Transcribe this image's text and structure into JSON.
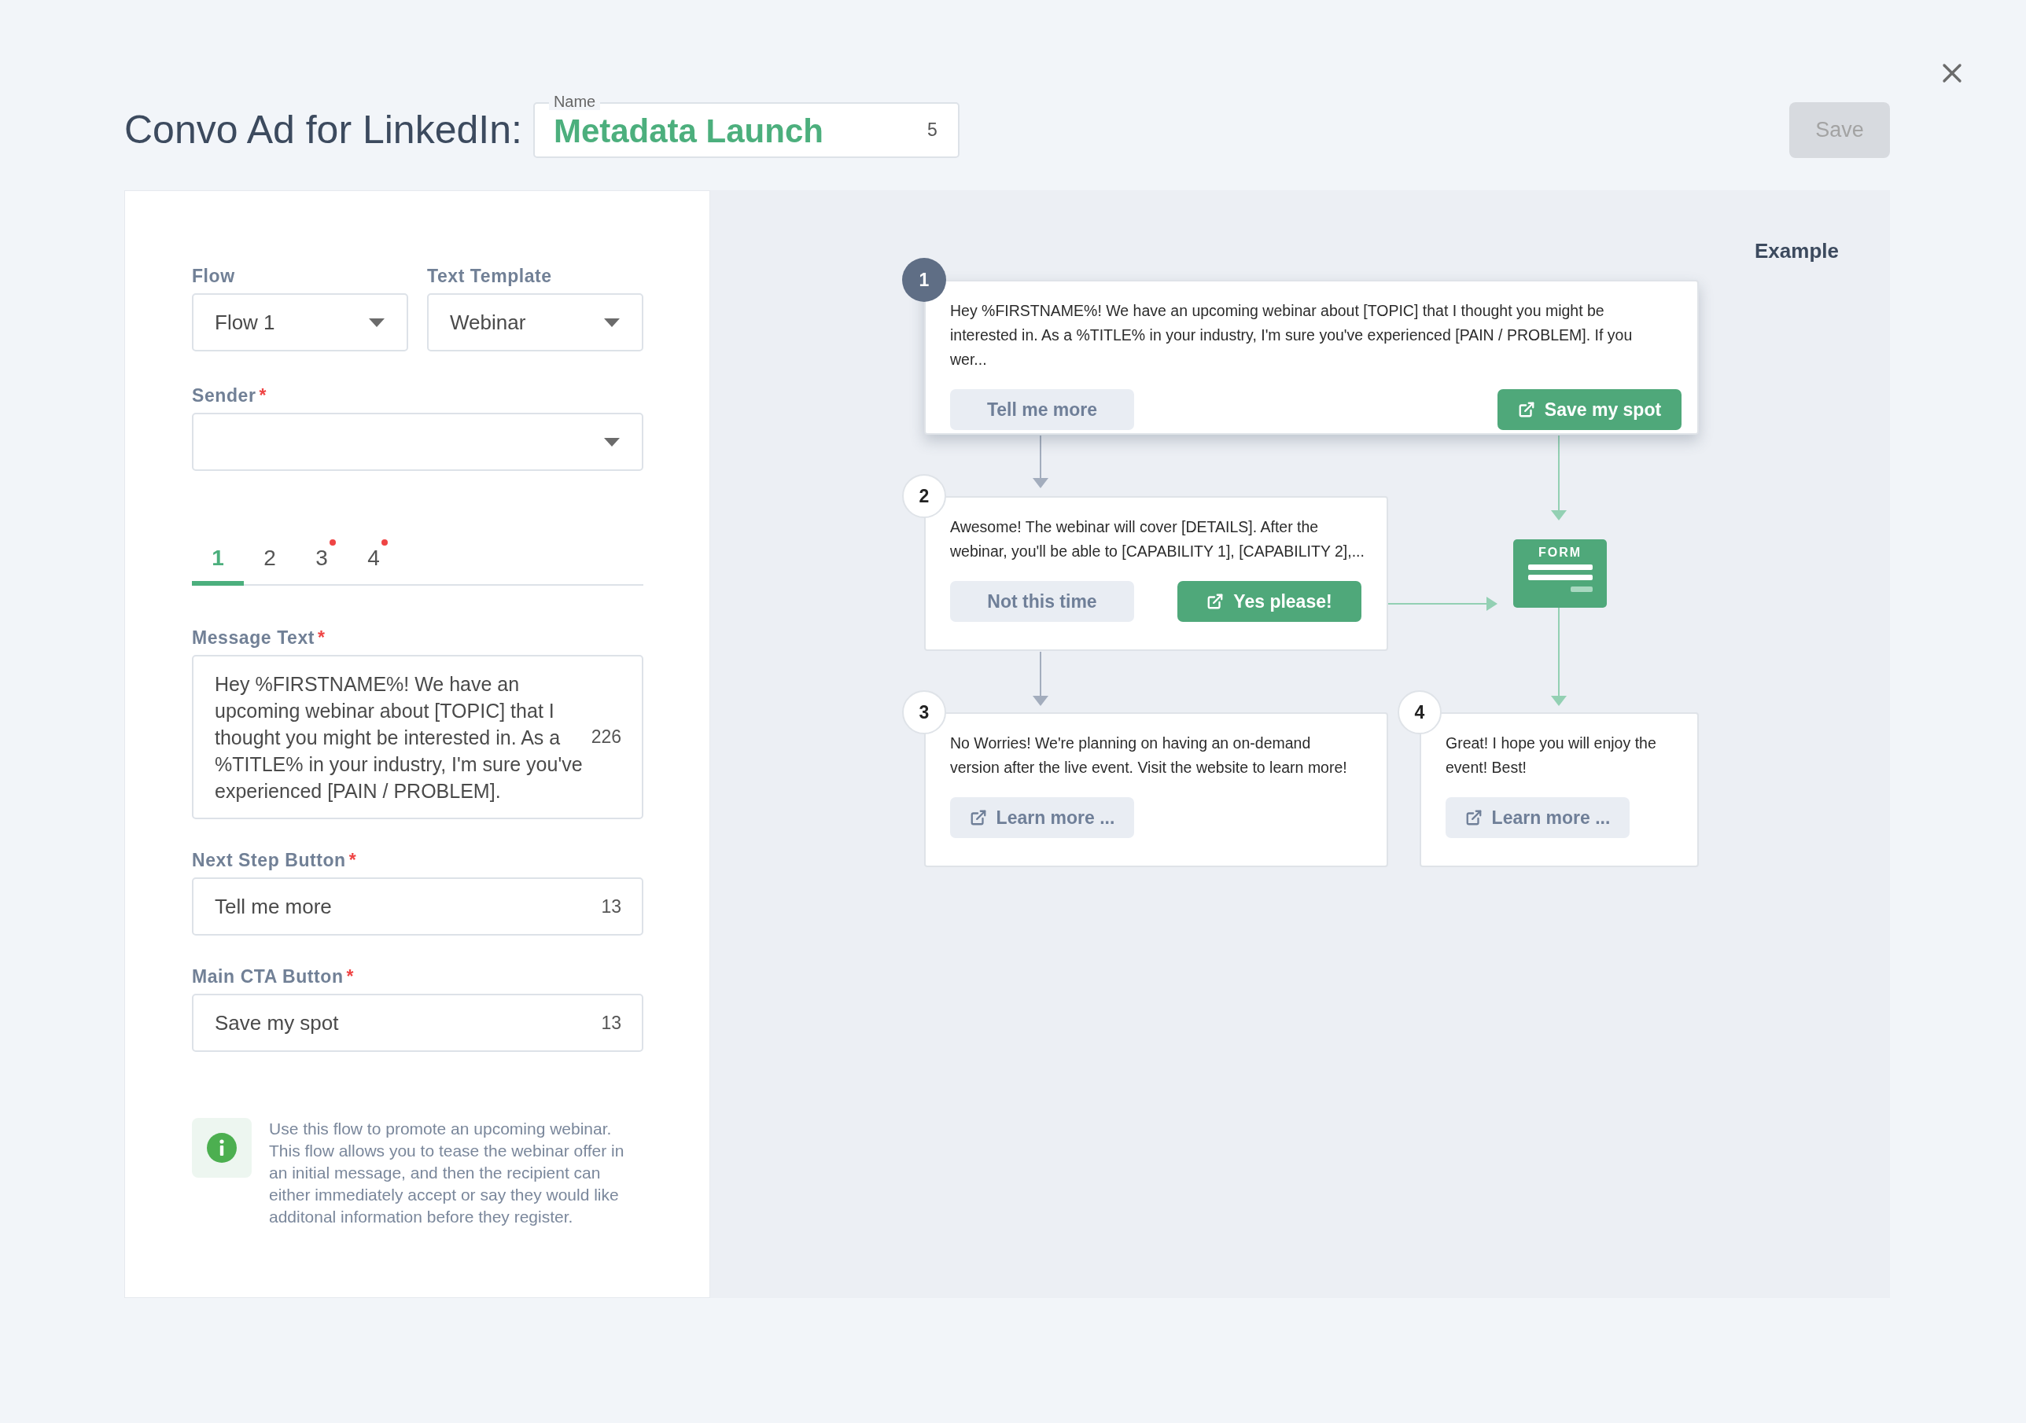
{
  "header": {
    "title": "Convo Ad for LinkedIn:",
    "name_field": {
      "label": "Name",
      "value": "Metadata Launch",
      "count": "5"
    },
    "save_button": {
      "label": "Save",
      "disabled": true
    }
  },
  "form": {
    "flow": {
      "label": "Flow",
      "value": "Flow 1"
    },
    "text_template": {
      "label": "Text Template",
      "value": "Webinar"
    },
    "sender": {
      "label": "Sender",
      "required": "*"
    },
    "tabs": [
      {
        "label": "1",
        "selected": true,
        "flagged": false
      },
      {
        "label": "2",
        "selected": false,
        "flagged": false
      },
      {
        "label": "3",
        "selected": false,
        "flagged": true
      },
      {
        "label": "4",
        "selected": false,
        "flagged": true
      }
    ],
    "message_text": {
      "label": "Message Text",
      "required": "*",
      "value": "Hey %FIRSTNAME%! We have an upcoming webinar about [TOPIC] that I thought you might be interested in. As a %TITLE% in your industry, I'm sure you've experienced [PAIN / PROBLEM].",
      "count": "226"
    },
    "next_step_button": {
      "label": "Next Step Button",
      "required": "*",
      "value": "Tell me more",
      "count": "13"
    },
    "main_cta_button": {
      "label": "Main CTA Button",
      "required": "*",
      "value": "Save my spot",
      "count": "13"
    },
    "info": "Use this flow to promote an upcoming webinar. This flow allows you to tease the webinar offer in an initial message, and then the recipient can either immediately accept or say they would like additonal information before they register."
  },
  "example": {
    "title": "Example",
    "form_label": "FORM",
    "steps": [
      {
        "number": "1",
        "active": true,
        "text": "Hey %FIRSTNAME%! We have an upcoming webinar about [TOPIC] that I thought you might be interested in. As a %TITLE% in your industry, I'm sure you've experienced [PAIN / PROBLEM]. If you wer...",
        "buttons": [
          {
            "label": "Tell me more",
            "kind": "secondary",
            "external": false
          },
          {
            "label": "Save my spot",
            "kind": "primary",
            "external": true
          }
        ]
      },
      {
        "number": "2",
        "active": false,
        "text": "Awesome! The webinar will cover [DETAILS]. After the webinar, you'll be able to [CAPABILITY 1], [CAPABILITY 2],...",
        "buttons": [
          {
            "label": "Not this time",
            "kind": "secondary",
            "external": false
          },
          {
            "label": "Yes please!",
            "kind": "primary",
            "external": true
          }
        ]
      },
      {
        "number": "3",
        "active": false,
        "text": "No Worries! We're planning on having an on-demand version after the live event. Visit the website to learn more!",
        "buttons": [
          {
            "label": "Learn more ...",
            "kind": "secondary",
            "external": true
          }
        ]
      },
      {
        "number": "4",
        "active": false,
        "text": "Great! I hope you will enjoy the event! Best!",
        "buttons": [
          {
            "label": "Learn more ...",
            "kind": "secondary",
            "external": true
          }
        ]
      }
    ]
  }
}
